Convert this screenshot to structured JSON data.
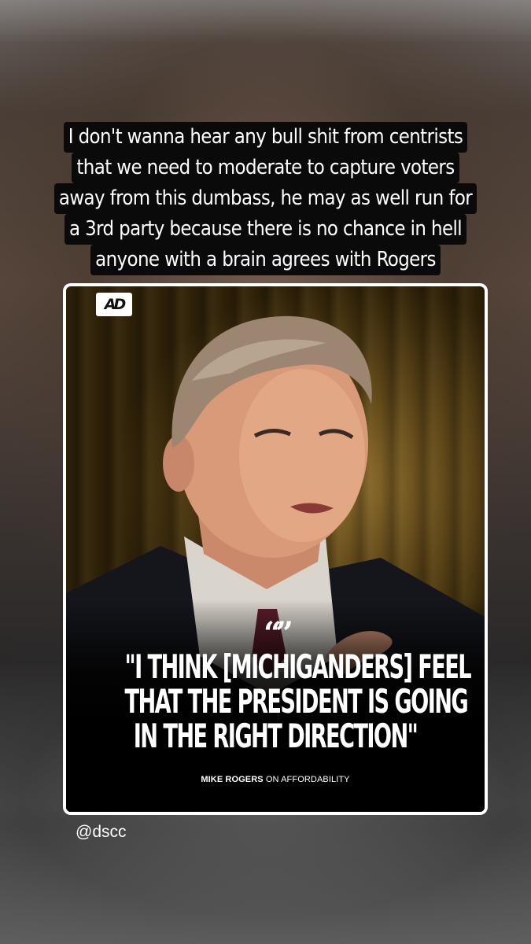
{
  "caption": {
    "lines": [
      "I don't wanna hear any bull shit from centrists",
      "that we need to moderate to capture voters",
      "away from this dumbass, he may as well run for",
      "a 3rd party because there is no chance in hell",
      "anyone with a brain agrees with Rogers"
    ]
  },
  "post": {
    "logo": "AD",
    "quote_mark": "“”",
    "quote_lines": [
      "\"I THINK [MICHIGANDERS] FEEL",
      "THAT THE PRESIDENT IS GOING",
      "IN THE RIGHT DIRECTION\""
    ],
    "attribution_name": "MIKE ROGERS",
    "attribution_topic": " ON AFFORDABILITY"
  },
  "mention": {
    "handle": "@dscc"
  },
  "colors": {
    "caption_highlight": "#0a0a0a",
    "text": "#ffffff",
    "card_border": "#ffffff"
  }
}
